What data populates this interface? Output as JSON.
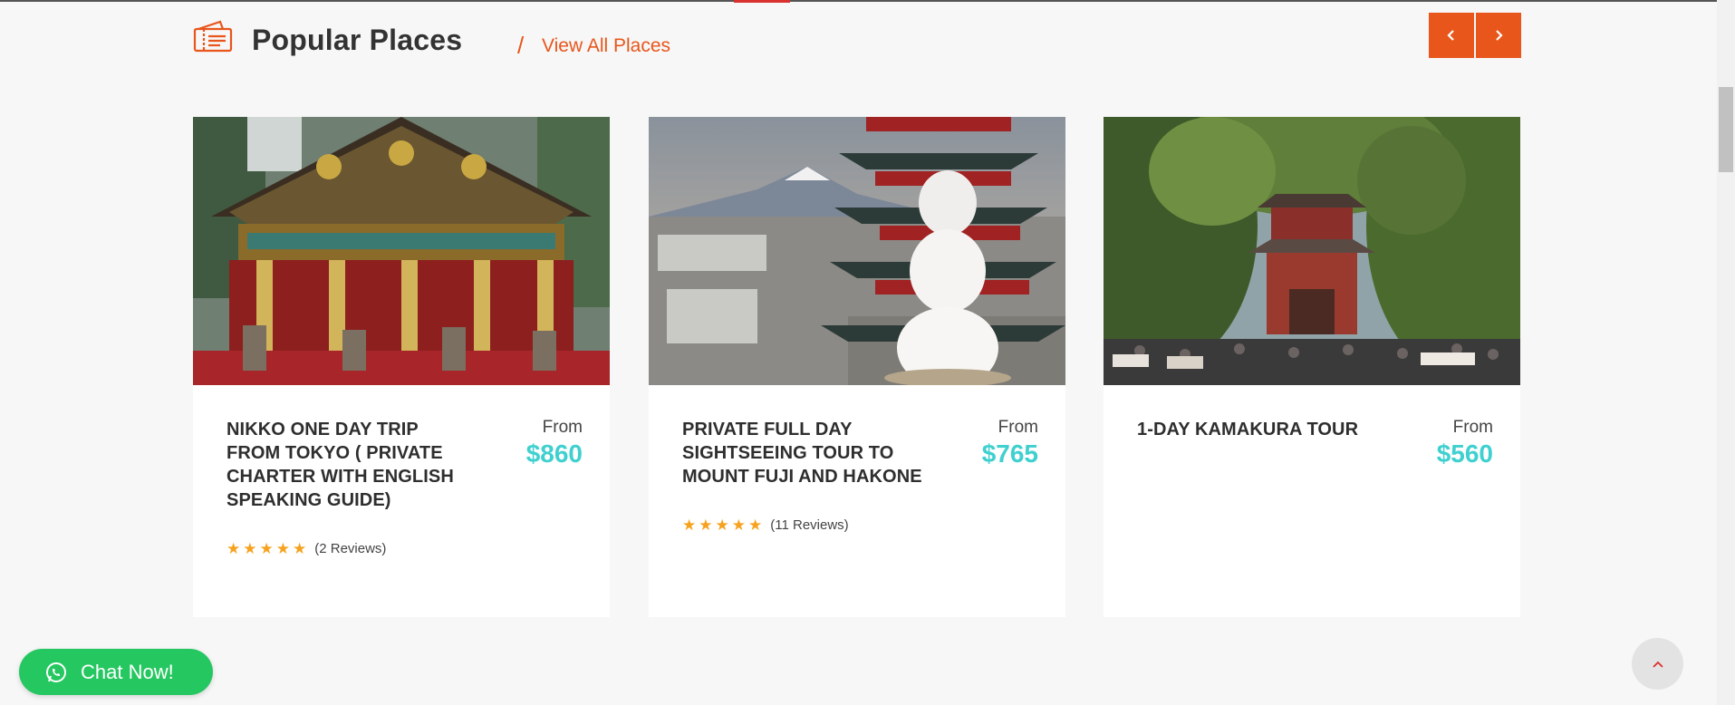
{
  "section": {
    "title": "Popular Places",
    "separator": "/",
    "view_all_label": "View All Places"
  },
  "carousel_nav": {
    "prev_icon": "chevron-left-icon",
    "next_icon": "chevron-right-icon"
  },
  "cards": [
    {
      "title": "NIKKO ONE DAY TRIP FROM TOKYO ( PRIVATE CHARTER WITH ENGLISH SPEAKING GUIDE)",
      "price_prefix": "From",
      "price": "$860",
      "rating": 5,
      "reviews": "(2 Reviews)"
    },
    {
      "title": "PRIVATE FULL DAY SIGHTSEEING TOUR TO MOUNT FUJI AND HAKONE",
      "price_prefix": "From",
      "price": "$765",
      "rating": 5,
      "reviews": "(11 Reviews)"
    },
    {
      "title": "1-DAY KAMAKURA TOUR",
      "price_prefix": "From",
      "price": "$560"
    }
  ],
  "chat": {
    "label": "Chat Now!",
    "icon": "whatsapp-icon"
  },
  "back_to_top": {
    "icon": "chevron-up-icon"
  },
  "colors": {
    "accent": "#e8561c",
    "price": "#3fd0cf",
    "star": "#f6a21e",
    "chat": "#25c760"
  }
}
